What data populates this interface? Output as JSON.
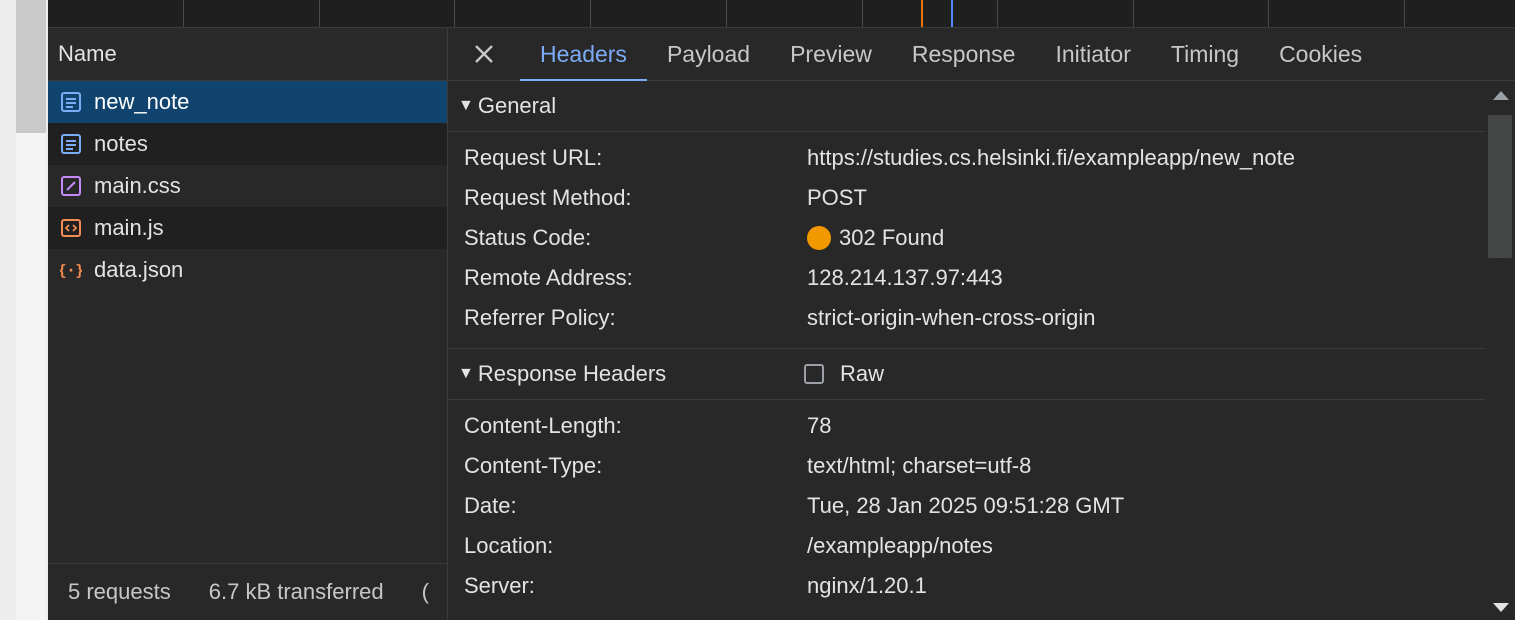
{
  "request_list": {
    "column_name": "Name",
    "items": [
      {
        "name": "new_note",
        "type": "document",
        "icon": "document-icon",
        "color": "#7cacf8"
      },
      {
        "name": "notes",
        "type": "document",
        "icon": "document-icon",
        "color": "#7cacf8"
      },
      {
        "name": "main.css",
        "type": "stylesheet",
        "icon": "stylesheet-icon",
        "color": "#c58af9"
      },
      {
        "name": "main.js",
        "type": "script",
        "icon": "script-icon",
        "color": "#f28b54"
      },
      {
        "name": "data.json",
        "type": "json",
        "icon": "json-icon",
        "color": "#f28b54"
      }
    ],
    "footer": {
      "requests": "5 requests",
      "transferred": "6.7 kB transferred",
      "truncated": "("
    }
  },
  "tabs": [
    "Headers",
    "Payload",
    "Preview",
    "Response",
    "Initiator",
    "Timing",
    "Cookies"
  ],
  "active_tab": "Headers",
  "general": {
    "title": "General",
    "rows": [
      {
        "key": "Request URL:",
        "value": "https://studies.cs.helsinki.fi/exampleapp/new_note"
      },
      {
        "key": "Request Method:",
        "value": "POST"
      },
      {
        "key": "Status Code:",
        "value": "302 Found"
      },
      {
        "key": "Remote Address:",
        "value": "128.214.137.97:443"
      },
      {
        "key": "Referrer Policy:",
        "value": "strict-origin-when-cross-origin"
      }
    ]
  },
  "response_headers": {
    "title": "Response Headers",
    "raw_label": "Raw",
    "rows": [
      {
        "key": "Content-Length:",
        "value": "78"
      },
      {
        "key": "Content-Type:",
        "value": "text/html; charset=utf-8"
      },
      {
        "key": "Date:",
        "value": "Tue, 28 Jan 2025 09:51:28 GMT"
      },
      {
        "key": "Location:",
        "value": "/exampleapp/notes"
      },
      {
        "key": "Server:",
        "value": "nginx/1.20.1"
      }
    ]
  },
  "colors": {
    "accent": "#7cacf8",
    "selected_row": "#10446e",
    "status_redirect": "#f29900"
  }
}
